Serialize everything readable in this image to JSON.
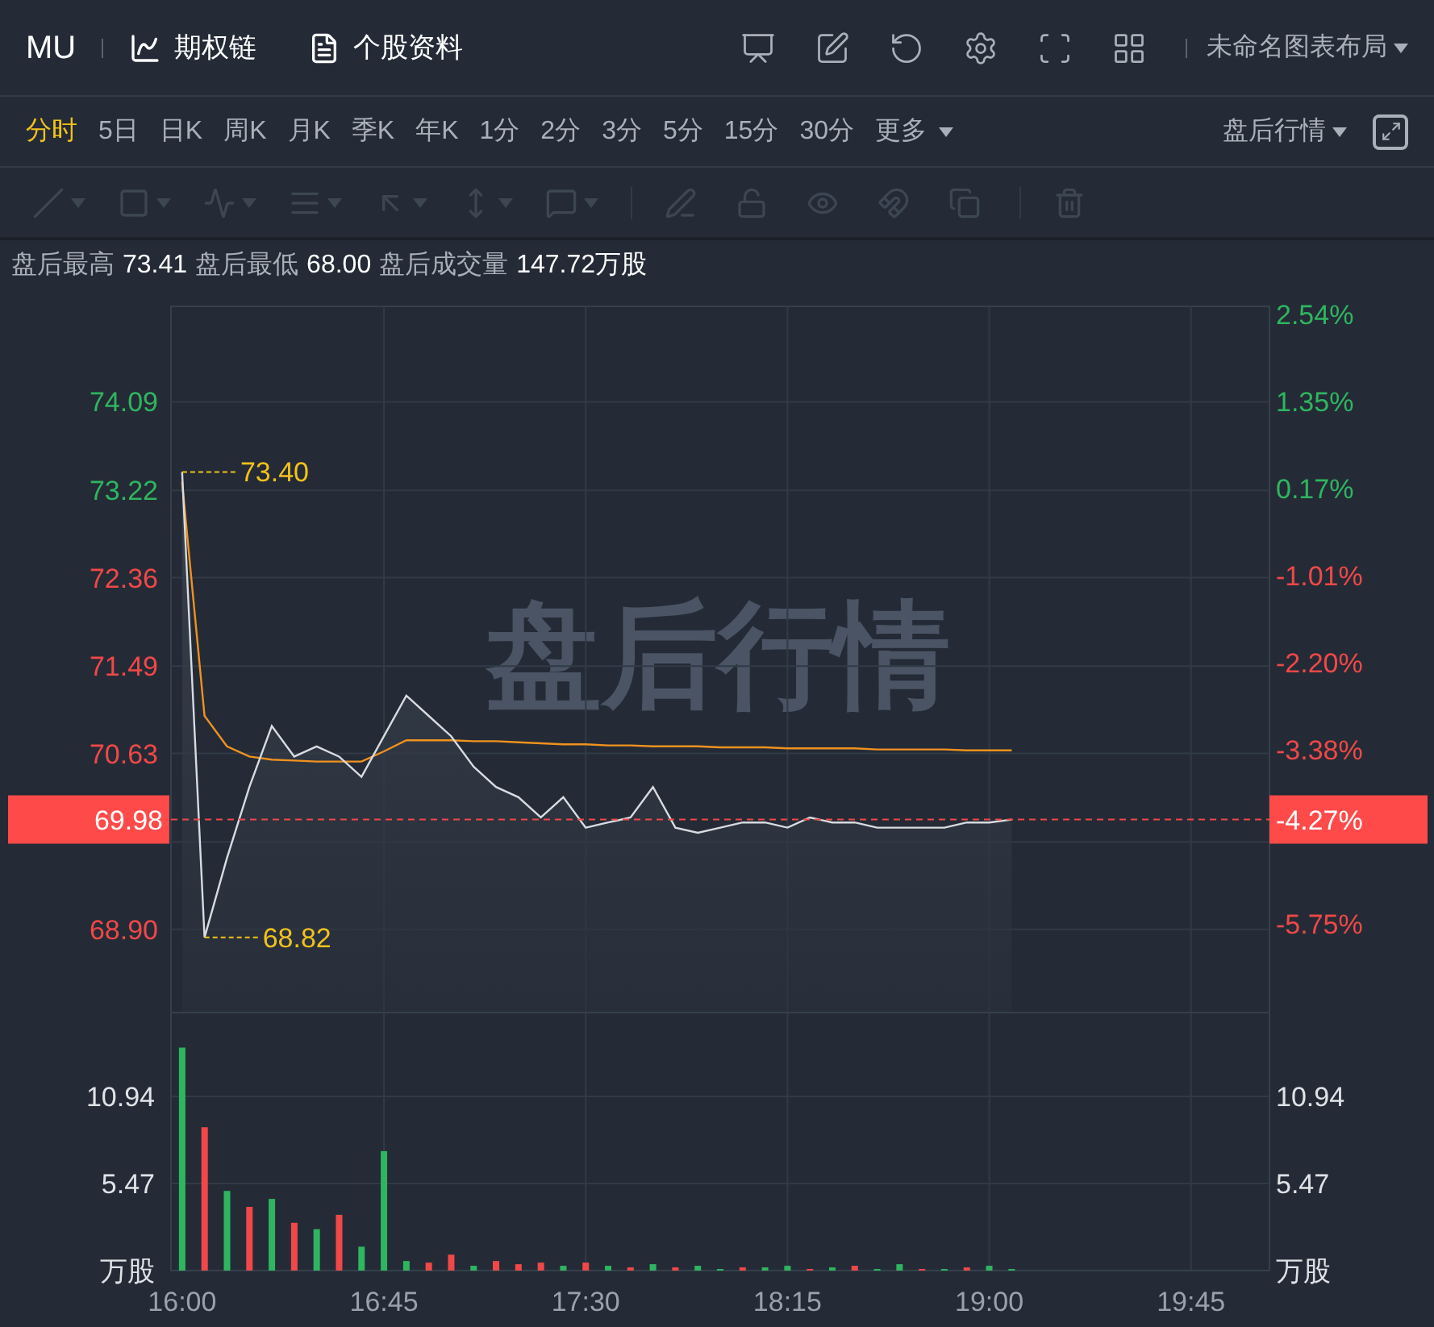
{
  "header": {
    "symbol": "MU",
    "links": [
      {
        "label": "期权链",
        "kind": "chart"
      },
      {
        "label": "个股资料",
        "kind": "doc"
      }
    ],
    "layout_menu": {
      "label": "未命名图表布局"
    }
  },
  "periods": [
    {
      "label": "分时",
      "selected": true
    },
    {
      "label": "5日",
      "selected": false
    },
    {
      "label": "日K",
      "selected": false
    },
    {
      "label": "周K",
      "selected": false
    },
    {
      "label": "月K",
      "selected": false
    },
    {
      "label": "季K",
      "selected": false
    },
    {
      "label": "年K",
      "selected": false
    },
    {
      "label": "1分",
      "selected": false
    },
    {
      "label": "2分",
      "selected": false
    },
    {
      "label": "3分",
      "selected": false
    },
    {
      "label": "5分",
      "selected": false
    },
    {
      "label": "15分",
      "selected": false
    },
    {
      "label": "30分",
      "selected": false
    }
  ],
  "more_menu": {
    "label": "更多"
  },
  "session_menu": {
    "label": "盘后行情"
  },
  "drawing_toolbar": {
    "disabled": true
  },
  "stats": [
    {
      "label": "盘后最高",
      "value": "73.41"
    },
    {
      "label": "盘后最低",
      "value": "68.00"
    },
    {
      "label": "盘后成交量",
      "value": "147.72万股"
    }
  ],
  "price_panel": {
    "chart_label": "盘后行情",
    "current_price_label": "69.98",
    "current_change_label": "-4.27%",
    "right_labels": [
      {
        "text": "2.54%",
        "color": "#2fb560"
      },
      {
        "text": "1.35%",
        "color": "#2fb560"
      },
      {
        "text": "0.17%",
        "color": "#2fb560"
      },
      {
        "text": "-1.01%",
        "color": "#f04848"
      },
      {
        "text": "-2.20%",
        "color": "#f04848"
      },
      {
        "text": "-3.38%",
        "color": "#f04848"
      },
      {
        "text": "-5.75%",
        "color": "#f04848"
      }
    ],
    "chart_data": {
      "type": "line",
      "categories": [
        null,
        null,
        null,
        null,
        null,
        null,
        null,
        null,
        null,
        null,
        null,
        null,
        null,
        null,
        null,
        null,
        null,
        null,
        null,
        null,
        null,
        null,
        null,
        null,
        null,
        null,
        null,
        null,
        null,
        null,
        null,
        null,
        null,
        null,
        null,
        null,
        null,
        null,
        null,
        null,
        null,
        null,
        null,
        null,
        null,
        null,
        null,
        null,
        null
      ],
      "series": [
        {
          "color": "#d8dbe0",
          "values": [
            73.4,
            68.82,
            69.6,
            70.3,
            70.9,
            70.6,
            70.7,
            70.6,
            70.4,
            70.8,
            71.2,
            71.0,
            70.8,
            70.5,
            70.3,
            70.2,
            70.0,
            70.2,
            69.9,
            69.95,
            70.0,
            70.3,
            69.9,
            69.85,
            69.9,
            69.95,
            69.95,
            69.9,
            70.0,
            69.95,
            69.95,
            69.9,
            69.9,
            69.9,
            69.9,
            69.95,
            69.95,
            69.98,
            null,
            null,
            null,
            null,
            null,
            null,
            null,
            null,
            null,
            null,
            null
          ]
        },
        {
          "color": "#f0921e",
          "values": [
            73.3,
            71.0,
            70.7,
            70.6,
            70.57,
            70.56,
            70.55,
            70.55,
            70.55,
            70.65,
            70.76,
            70.76,
            70.76,
            70.75,
            70.75,
            70.74,
            70.73,
            70.72,
            70.72,
            70.71,
            70.71,
            70.7,
            70.7,
            70.7,
            70.69,
            70.69,
            70.69,
            70.68,
            70.68,
            70.68,
            70.68,
            70.67,
            70.67,
            70.67,
            70.67,
            70.66,
            70.66,
            70.66,
            null,
            null,
            null,
            null,
            null,
            null,
            null,
            null,
            null,
            null,
            null
          ]
        }
      ],
      "grid": true,
      "ylim": [
        68.08,
        75.03
      ],
      "yticks": [
        {
          "value": 74.09,
          "label": "74.09"
        },
        {
          "value": 73.22,
          "label": "73.22"
        },
        {
          "value": 72.36,
          "label": "72.36"
        },
        {
          "value": 71.49,
          "label": "71.49"
        },
        {
          "value": 70.63,
          "label": "70.63"
        },
        {
          "value": 68.9,
          "label": "68.90"
        }
      ],
      "annotations": [
        "73.40",
        "68.82"
      ]
    }
  },
  "volume_panel": {
    "unit_left": "万股",
    "unit_right": "万股",
    "right_labels": [
      "10.94",
      "5.47"
    ],
    "chart_data": {
      "type": "bar",
      "stacked": true,
      "categories": [
        "16:00",
        null,
        null,
        null,
        null,
        null,
        null,
        null,
        null,
        "16:45",
        null,
        null,
        null,
        null,
        null,
        null,
        null,
        null,
        "17:30",
        null,
        null,
        null,
        null,
        null,
        null,
        null,
        null,
        "18:15",
        null,
        null,
        null,
        null,
        null,
        null,
        null,
        null,
        "19:00",
        null,
        null,
        null,
        null,
        null,
        null,
        null,
        null,
        "19:45",
        null,
        null,
        null
      ],
      "series": [
        {
          "color": "#2fb560",
          "values": [
            14,
            null,
            5,
            null,
            4.5,
            null,
            2.6,
            null,
            1.5,
            7.5,
            0.6,
            null,
            null,
            0.3,
            null,
            null,
            null,
            0.3,
            null,
            0.3,
            null,
            0.4,
            null,
            0.3,
            0.1,
            null,
            0.2,
            0.3,
            null,
            0.2,
            null,
            0.1,
            0.4,
            null,
            0.1,
            null,
            0.3,
            0.1,
            null,
            null,
            null,
            null,
            null,
            null,
            null,
            null,
            null,
            null,
            null
          ]
        },
        {
          "color": "#f04848",
          "values": [
            null,
            9,
            null,
            4,
            null,
            3,
            null,
            3.5,
            null,
            null,
            null,
            0.5,
            1,
            null,
            0.6,
            0.4,
            0.5,
            null,
            0.5,
            null,
            0.2,
            null,
            0.2,
            null,
            null,
            0.2,
            null,
            null,
            0.1,
            null,
            0.3,
            null,
            null,
            0.1,
            null,
            0.2,
            null,
            null,
            null,
            null,
            null,
            null,
            null,
            null,
            null,
            null,
            null,
            null,
            null
          ]
        }
      ],
      "grid": true,
      "ylim": [
        0,
        16.2
      ],
      "yticks": [
        {
          "value": 5.47,
          "label": "5.47"
        },
        {
          "value": 10.94,
          "label": "10.94"
        }
      ]
    }
  }
}
